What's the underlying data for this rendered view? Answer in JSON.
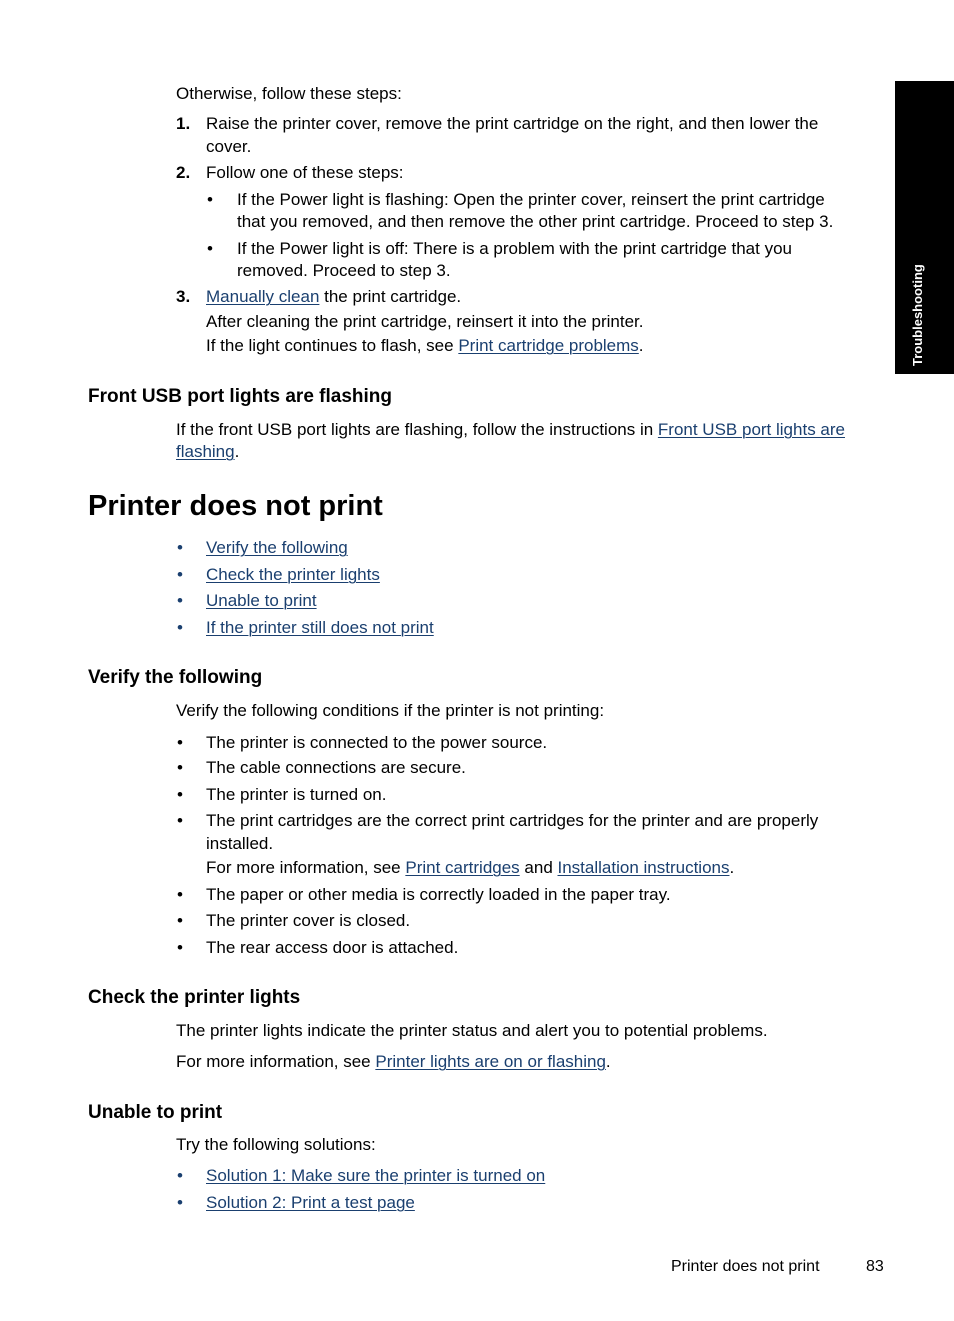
{
  "side_tab": {
    "label": "Troubleshooting"
  },
  "intro": {
    "text": "Otherwise, follow these steps:",
    "steps": [
      {
        "num": "1.",
        "lines": [
          "Raise the printer cover, remove the print cartridge on the right, and then lower the",
          "cover."
        ]
      },
      {
        "num": "2.",
        "text": "Follow one of these steps:",
        "bullets": [
          {
            "lines": [
              "If the Power light is flashing: Open the printer cover, reinsert the print cartridge",
              "that you removed, and then remove the other print cartridge. Proceed to step 3."
            ]
          },
          {
            "lines": [
              "If the Power light is off: There is a problem with the print cartridge that you",
              "removed. Proceed to step 3."
            ]
          }
        ]
      },
      {
        "num": "3.",
        "link": "Manually clean",
        "after_link": " the print cartridge.",
        "line2": "After cleaning the print cartridge, reinsert it into the printer.",
        "line3_before": "If the light continues to flash, see ",
        "line3_link": "Print cartridge problems",
        "line3_after": "."
      }
    ]
  },
  "usb_section": {
    "heading": "Front USB port lights are flashing",
    "text_before": "If the front USB port lights are flashing, follow the instructions in ",
    "link_line1": "Front USB port lights are",
    "link_line2": "flashing",
    "text_after": "."
  },
  "main": {
    "title": "Printer does not print",
    "toc": [
      "Verify the following",
      "Check the printer lights",
      "Unable to print",
      "If the printer still does not print"
    ]
  },
  "verify": {
    "heading": "Verify the following",
    "intro": "Verify the following conditions if the printer is not printing:",
    "items": [
      "The printer is connected to the power source.",
      "The cable connections are secure.",
      "The printer is turned on.",
      "The print cartridges are the correct print cartridges for the printer and are properly",
      "installed.",
      "The paper or other media is correctly loaded in the paper tray.",
      "The printer cover is closed.",
      "The rear access door is attached."
    ],
    "more_info_before": "For more information, see ",
    "more_info_link1": "Print cartridges",
    "more_info_mid": " and ",
    "more_info_link2": "Installation instructions",
    "more_info_after": "."
  },
  "lights": {
    "heading": "Check the printer lights",
    "text": "The printer lights indicate the printer status and alert you to potential problems.",
    "more_before": "For more information, see ",
    "more_link": "Printer lights are on or flashing",
    "more_after": "."
  },
  "unable": {
    "heading": "Unable to print",
    "intro": "Try the following solutions:",
    "solutions": [
      "Solution 1: Make sure the printer is turned on",
      "Solution 2: Print a test page"
    ]
  },
  "footer": {
    "title": "Printer does not print",
    "page": "83"
  },
  "bullet_char": "•",
  "colors": {
    "link": "#1a3f6f",
    "tab_bg": "#000000"
  }
}
